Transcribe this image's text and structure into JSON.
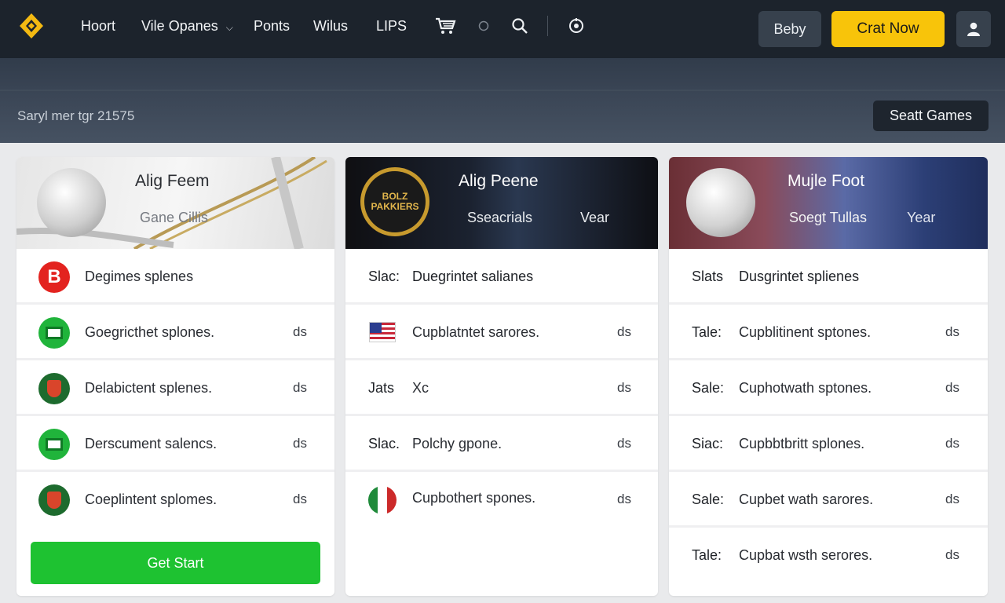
{
  "nav": {
    "items": [
      "Hoort",
      "Vile Opanes",
      "Ponts",
      "Wilus",
      "LIPS"
    ],
    "login_label": "Beby",
    "cta_label": "Crat Now"
  },
  "banner": {
    "text": "Saryl mer tgr 21575",
    "games_button": "Seatt Games"
  },
  "cards": [
    {
      "title": "Alig Feem",
      "subtitle": "Gane Cillis",
      "rows": [
        {
          "label": "Degimes splenes",
          "icon": "b-red-icon"
        },
        {
          "label": "Goegricthet splones.",
          "suffix": "ds",
          "icon": "green-flag-icon"
        },
        {
          "label": "Delabictent splenes.",
          "suffix": "ds",
          "icon": "crest-icon"
        },
        {
          "label": "Derscument salencs.",
          "suffix": "ds",
          "icon": "green-flag-icon"
        },
        {
          "label": "Coeplintent splomes.",
          "suffix": "ds",
          "icon": "crest-icon"
        }
      ],
      "button": "Get Start"
    },
    {
      "title": "Alig Peene",
      "sub_left": "Sseacrials",
      "sub_right": "Vear",
      "logo_text": "BOLZ PAKKIERS",
      "rows": [
        {
          "prefix": "Slac:",
          "label": "Duegrintet salianes"
        },
        {
          "label": "Cupblatntet sarores.",
          "suffix": "ds",
          "icon": "us-flag-icon"
        },
        {
          "prefix": "Jats",
          "label": "Xc",
          "suffix": "ds"
        },
        {
          "prefix": "Slac.",
          "label": "Polchy gpone.",
          "suffix": "ds"
        },
        {
          "label": "Cupbothert spones.",
          "suffix": "ds",
          "icon": "flag-badge-icon"
        }
      ]
    },
    {
      "title": "Mujle Foot",
      "sub_left": "Soegt Tullas",
      "sub_right": "Year",
      "rows": [
        {
          "prefix": "Slats",
          "label": "Dusgrintet splienes"
        },
        {
          "prefix": "Tale:",
          "label": "Cupblitinent sptones.",
          "suffix": "ds"
        },
        {
          "prefix": "Sale:",
          "label": "Cuphotwath sptones.",
          "suffix": "ds"
        },
        {
          "prefix": "Siac:",
          "label": "Cupbbtbritt splones.",
          "suffix": "ds"
        },
        {
          "prefix": "Sale:",
          "label": "Cupbet wath sarores.",
          "suffix": "ds"
        },
        {
          "prefix": "Tale:",
          "label": "Cupbat wsth serores.",
          "suffix": "ds"
        }
      ]
    }
  ]
}
